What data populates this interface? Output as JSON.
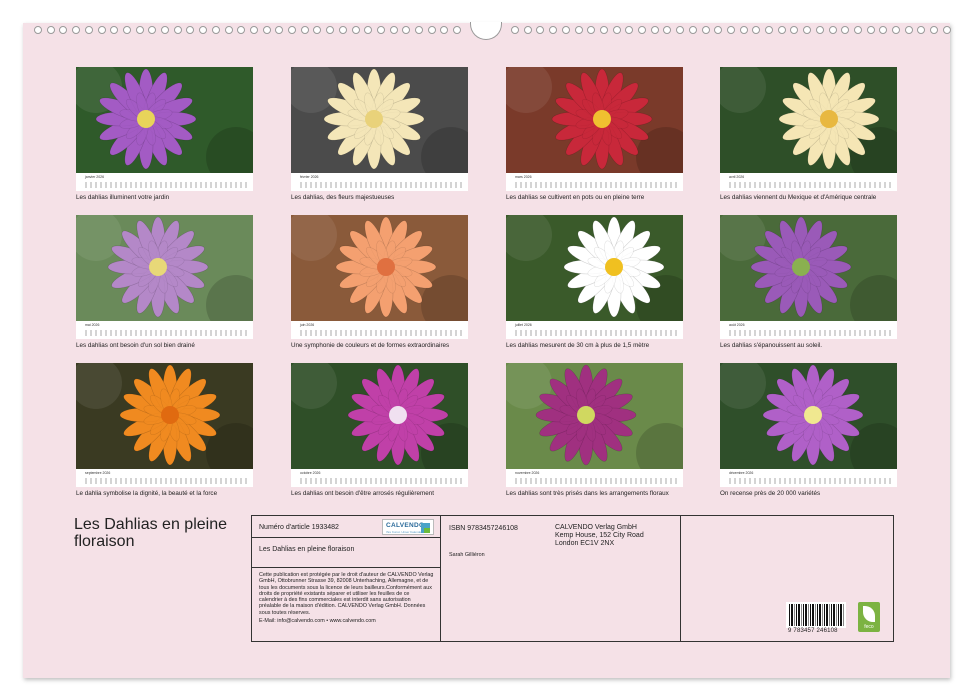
{
  "months": [
    {
      "name": "janvier 2026",
      "caption": "Les dahlias illuminent votre jardin",
      "bg": "#2f5a2a",
      "petal": "#a35bc4",
      "center": "#e8d45a"
    },
    {
      "name": "février 2026",
      "caption": "Les dahlias, des fleurs majestueuses",
      "bg": "#4b4b4b",
      "petal": "#f4e6b8",
      "center": "#e9d27a"
    },
    {
      "name": "mars 2026",
      "caption": "Les dahlias se cultivent en pots ou en pleine terre",
      "bg": "#7a3a2a",
      "petal": "#c8283a",
      "center": "#f0c030"
    },
    {
      "name": "avril 2026",
      "caption": "Les dahlias viennent du Mexique et d'Amérique centrale",
      "bg": "#2e4f28",
      "petal": "#f5e6b5",
      "center": "#e8b840"
    },
    {
      "name": "mai 2026",
      "caption": "Les dahlias ont besoin d'un sol bien drainé",
      "bg": "#6a8a5a",
      "petal": "#b488c8",
      "center": "#e8d878"
    },
    {
      "name": "juin 2026",
      "caption": "Une symphonie de couleurs et de formes extraordinaires",
      "bg": "#8a5a3a",
      "petal": "#f4a070",
      "center": "#e07040"
    },
    {
      "name": "juillet 2026",
      "caption": "Les dahlias mesurent de 30 cm à plus de 1,5 mètre",
      "bg": "#3a5a2a",
      "petal": "#ffffff",
      "center": "#f0c020"
    },
    {
      "name": "août 2026",
      "caption": "Les dahlias s'épanouissent au soleil.",
      "bg": "#4a6a3a",
      "petal": "#9a5ab8",
      "center": "#8ab050"
    },
    {
      "name": "septembre 2026",
      "caption": "Le dahlia symbolise la dignité, la beauté et la force",
      "bg": "#3a3a22",
      "petal": "#f08a20",
      "center": "#e06a10"
    },
    {
      "name": "octobre 2026",
      "caption": "Les dahlias ont besoin d'être arrosés régulièrement",
      "bg": "#2f4f28",
      "petal": "#c040a8",
      "center": "#f0e0f0"
    },
    {
      "name": "novembre 2026",
      "caption": "Les dahlias sont très prisés dans les arrangements floraux",
      "bg": "#6a8a4a",
      "petal": "#a03080",
      "center": "#d0d860"
    },
    {
      "name": "décembre 2026",
      "caption": "On recense près de 20 000 variétés",
      "bg": "#2f4f2a",
      "petal": "#b060c8",
      "center": "#f0e890"
    }
  ],
  "book_title": "Les Dahlias en pleine floraison",
  "info": {
    "article_label": "Numéro d'article 1933482",
    "title": "Les Dahlias en pleine floraison",
    "copyright": "Cette publication est protégée par le droit d'auteur de CALVENDO Verlag GmbH, Ottobrunner Strasse 39, 82008 Unterhaching, Allemagne, et de tous les documents sous la licence de leurs bailleurs.Conformément aux droits de propriété existants séparer et utiliser les feuilles de ce calendrier à des fins commerciales est interdit sans autorisation préalable de la maison d'édition. CALVENDO Verlag GmbH. Données sous toutes réserves.",
    "email": "E-Mail: info@calvendo.com • www.calvendo.com",
    "isbn": "ISBN 9783457246108",
    "author": "Sarah Gilliéron",
    "publisher_name": "CALVENDO Verlag GmbH",
    "publisher_street": "Kemp House, 152 City Road",
    "publisher_city": "London EC1V 2NX",
    "barcode_number": "9 783457 246108",
    "logo_text": "CALVENDO",
    "logo_sub": "Ihre Kunst. Unser Kalender.",
    "feco_label": "feco"
  }
}
